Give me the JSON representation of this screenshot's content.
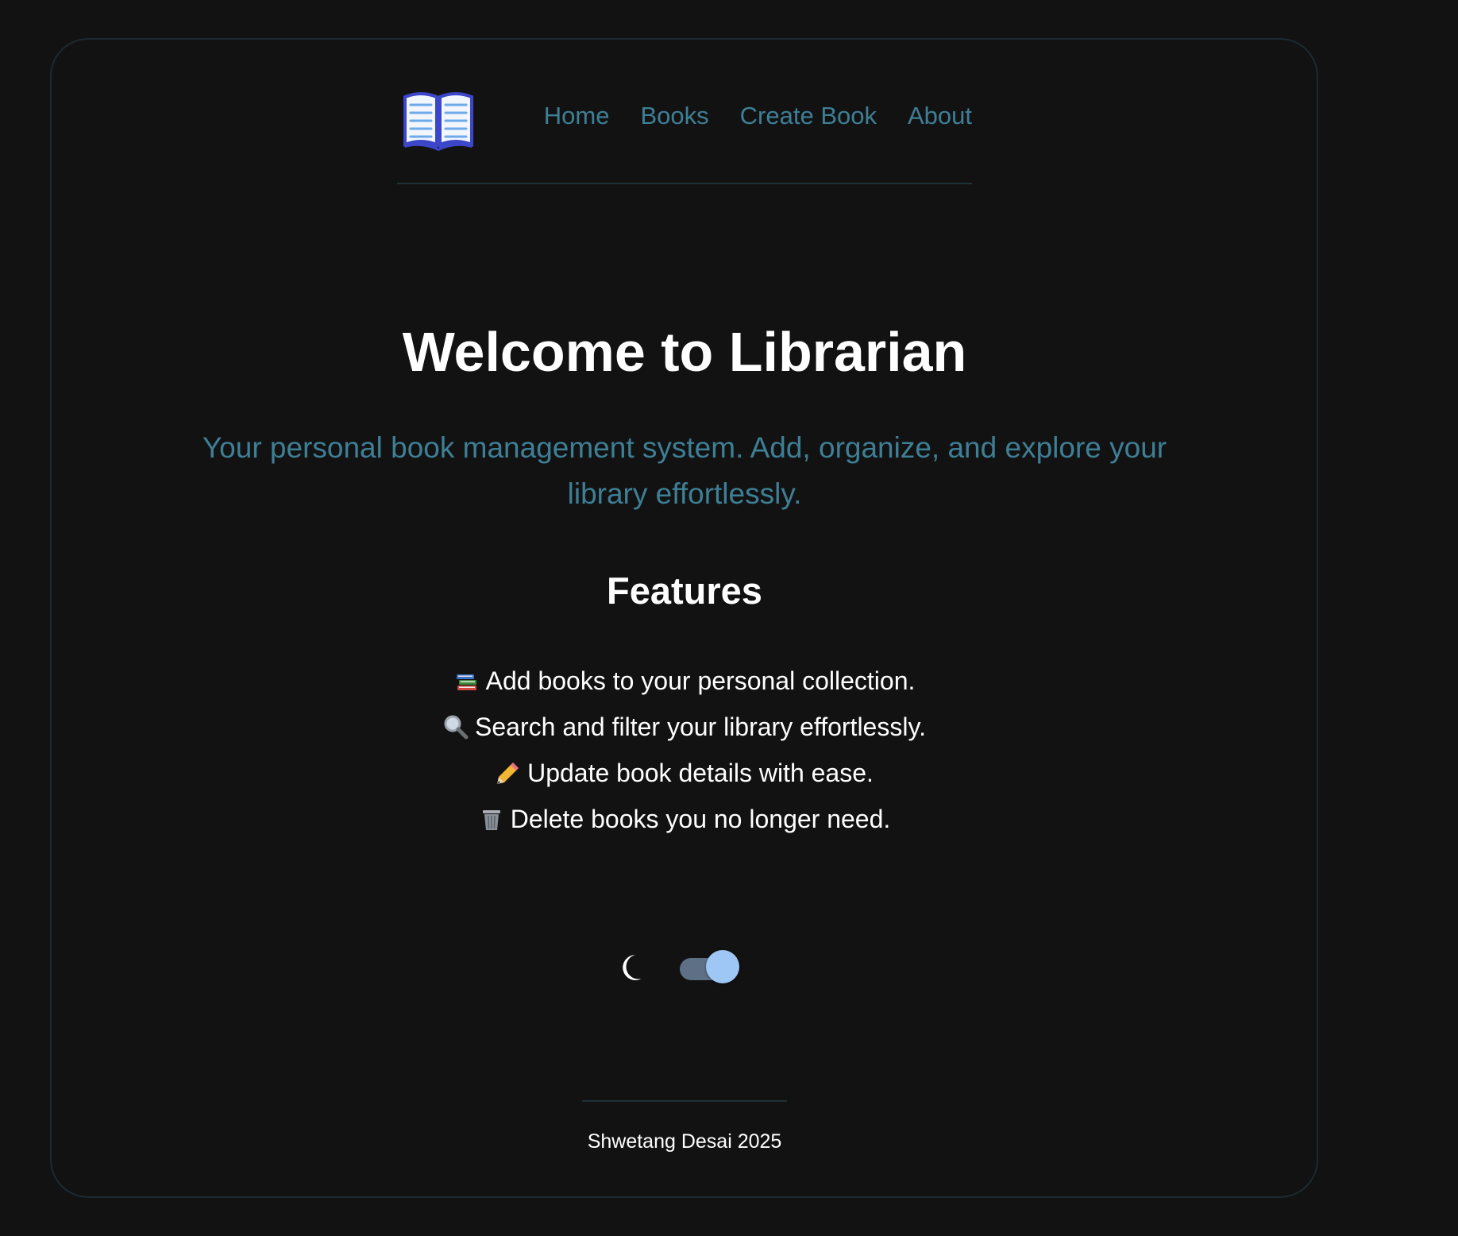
{
  "nav": {
    "links": [
      {
        "label": "Home"
      },
      {
        "label": "Books"
      },
      {
        "label": "Create Book"
      },
      {
        "label": "About"
      }
    ]
  },
  "hero": {
    "title": "Welcome to Librarian",
    "subtitle": "Your personal book management system. Add, organize, and explore your library effortlessly."
  },
  "features": {
    "heading": "Features",
    "items": [
      {
        "icon": "books-icon",
        "text": "Add books to your personal collection."
      },
      {
        "icon": "magnifier-icon",
        "text": "Search and filter your library effortlessly."
      },
      {
        "icon": "pencil-icon",
        "text": "Update book details with ease."
      },
      {
        "icon": "trash-icon",
        "text": "Delete books you no longer need."
      }
    ]
  },
  "theme": {
    "icon": "moon-icon",
    "dark_mode": true
  },
  "footer": {
    "text": "Shwetang Desai 2025"
  },
  "colors": {
    "background": "#121212",
    "link": "#3e7f96",
    "text": "#ffffff",
    "toggle_track": "#5e7086",
    "toggle_knob": "#9ec7f6"
  }
}
